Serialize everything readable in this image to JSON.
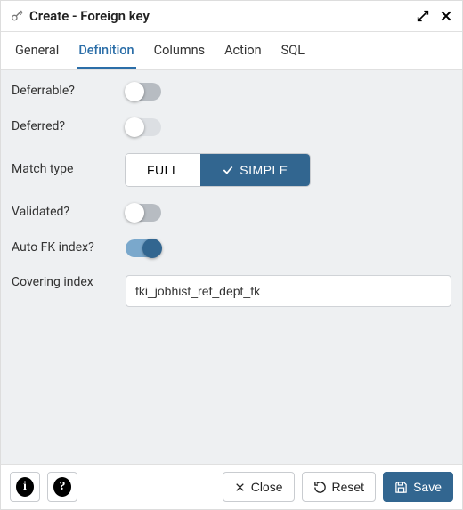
{
  "header": {
    "title": "Create - Foreign key"
  },
  "tabs": [
    {
      "label": "General",
      "active": false
    },
    {
      "label": "Definition",
      "active": true
    },
    {
      "label": "Columns",
      "active": false
    },
    {
      "label": "Action",
      "active": false
    },
    {
      "label": "SQL",
      "active": false
    }
  ],
  "fields": {
    "deferrable": {
      "label": "Deferrable?",
      "value": false
    },
    "deferred": {
      "label": "Deferred?",
      "value": false
    },
    "match_type": {
      "label": "Match type",
      "options": [
        "FULL",
        "SIMPLE"
      ],
      "selected": "SIMPLE"
    },
    "validated": {
      "label": "Validated?",
      "value": false
    },
    "auto_fk_index": {
      "label": "Auto FK index?",
      "value": true
    },
    "covering_index": {
      "label": "Covering index",
      "value": "fki_jobhist_ref_dept_fk"
    }
  },
  "footer": {
    "close": "Close",
    "reset": "Reset",
    "save": "Save"
  }
}
